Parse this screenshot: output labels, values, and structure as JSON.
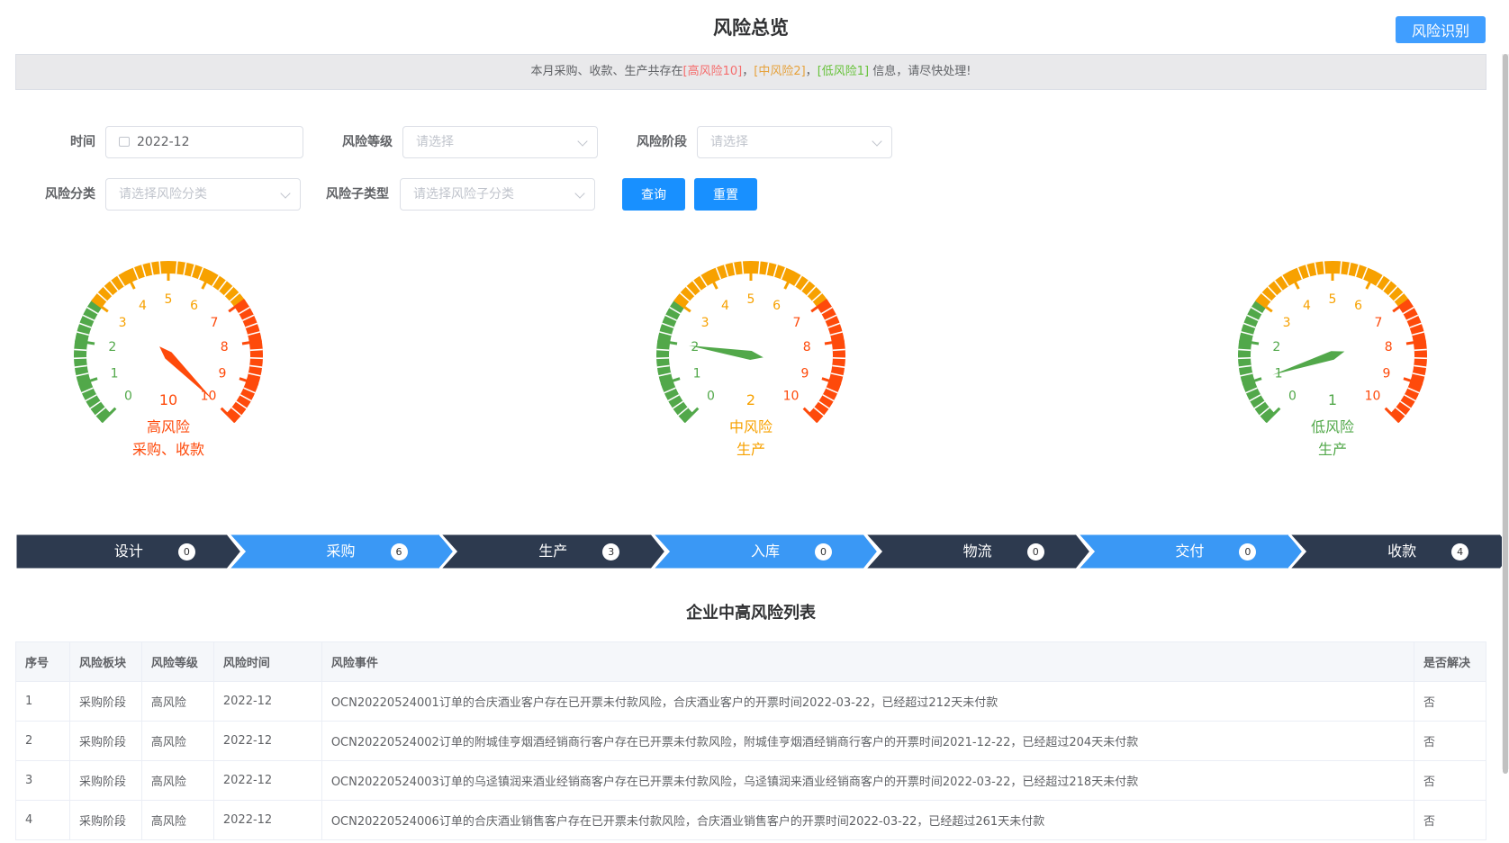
{
  "header": {
    "title": "风险总览",
    "identify_button": "风险识别"
  },
  "notice": {
    "prefix": "本月采购、收款、生产共存在",
    "high": "[高风险10]",
    "sep1": "，",
    "mid": "[中风险2]",
    "sep2": "，",
    "low": "[低风险1]",
    "suffix": "信息，请尽快处理!"
  },
  "filters": {
    "time_label": "时间",
    "time_value": "2022-12",
    "level_label": "风险等级",
    "level_placeholder": "请选择",
    "stage_label": "风险阶段",
    "stage_placeholder": "请选择",
    "category_label": "风险分类",
    "category_placeholder": "请选择风险分类",
    "subtype_label": "风险子类型",
    "subtype_placeholder": "请选择风险子分类",
    "query_button": "查询",
    "reset_button": "重置"
  },
  "colors": {
    "green": "#52a84a",
    "orange": "#f7a100",
    "red": "#fe4a0b",
    "primary": "#1890ff",
    "dark": "#2d3a4f",
    "blue": "#3a98f5"
  },
  "gauges": [
    {
      "value": 10,
      "value_label": "10",
      "level": "高风险",
      "stage": "采购、收款",
      "color": "#fe4a0b",
      "needle_color": "#fe4a0b"
    },
    {
      "value": 2,
      "value_label": "2",
      "level": "中风险",
      "stage": "生产",
      "color": "#f7a100",
      "needle_color": "#52a84a"
    },
    {
      "value": 1,
      "value_label": "1",
      "level": "低风险",
      "stage": "生产",
      "color": "#52a84a",
      "needle_color": "#52a84a"
    }
  ],
  "gauge_scale": {
    "min": 0,
    "max": 10,
    "ticks": [
      "0",
      "1",
      "2",
      "3",
      "4",
      "5",
      "6",
      "7",
      "8",
      "9",
      "10"
    ]
  },
  "steps": [
    {
      "label": "设计",
      "count": "0",
      "theme": "dark"
    },
    {
      "label": "采购",
      "count": "6",
      "theme": "blue"
    },
    {
      "label": "生产",
      "count": "3",
      "theme": "dark"
    },
    {
      "label": "入库",
      "count": "0",
      "theme": "blue"
    },
    {
      "label": "物流",
      "count": "0",
      "theme": "dark"
    },
    {
      "label": "交付",
      "count": "0",
      "theme": "blue"
    },
    {
      "label": "收款",
      "count": "4",
      "theme": "dark"
    }
  ],
  "table": {
    "title": "企业中高风险列表",
    "columns": [
      "序号",
      "风险板块",
      "风险等级",
      "风险时间",
      "风险事件",
      "是否解决"
    ],
    "rows": [
      [
        "1",
        "采购阶段",
        "高风险",
        "2022-12",
        "OCN20220524001订单的合庆酒业客户存在已开票未付款风险，合庆酒业客户的开票时间2022-03-22，已经超过212天未付款",
        "否"
      ],
      [
        "2",
        "采购阶段",
        "高风险",
        "2022-12",
        "OCN20220524002订单的附城佳亨烟酒经销商行客户存在已开票未付款风险，附城佳亨烟酒经销商行客户的开票时间2021-12-22，已经超过204天未付款",
        "否"
      ],
      [
        "3",
        "采购阶段",
        "高风险",
        "2022-12",
        "OCN20220524003订单的乌迳镇润来酒业经销商客户存在已开票未付款风险，乌迳镇润来酒业经销商客户的开票时间2022-03-22，已经超过218天未付款",
        "否"
      ],
      [
        "4",
        "采购阶段",
        "高风险",
        "2022-12",
        "OCN20220524006订单的合庆酒业销售客户存在已开票未付款风险，合庆酒业销售客户的开票时间2022-03-22，已经超过261天未付款",
        "否"
      ]
    ]
  }
}
